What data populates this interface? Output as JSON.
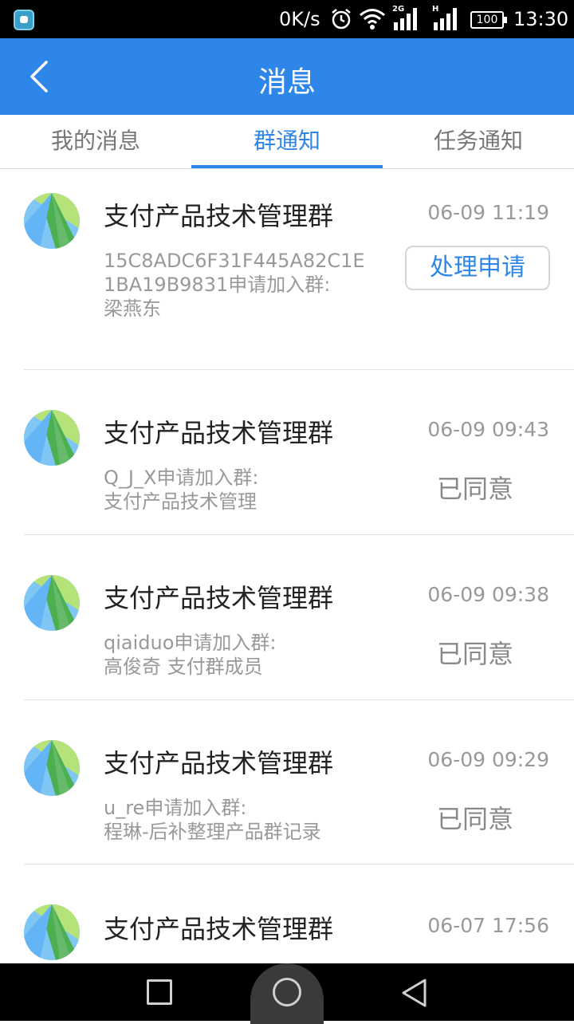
{
  "status_bar": {
    "net_speed": "0K/s",
    "network_2g": "2G",
    "network_h": "H",
    "battery": "100",
    "time": "13:30"
  },
  "header": {
    "title": "消息",
    "back_icon": "chevron-left-icon"
  },
  "tabs": [
    {
      "label": "我的消息",
      "active": false
    },
    {
      "label": "群通知",
      "active": true
    },
    {
      "label": "任务通知",
      "active": false
    }
  ],
  "notifications": [
    {
      "group": "支付产品技术管理群",
      "time": "06-09 11:19",
      "desc_line1": "15C8ADC6F31F445A82C1E1BA19B9831申请加入群:",
      "desc_line2": "梁燕东",
      "action_button": "处理申请"
    },
    {
      "group": "支付产品技术管理群",
      "time": "06-09 09:43",
      "desc_line1": "Q_J_X申请加入群:",
      "desc_line2": "支付产品技术管理",
      "status": "已同意"
    },
    {
      "group": "支付产品技术管理群",
      "time": "06-09 09:38",
      "desc_line1": "qiaiduo申请加入群:",
      "desc_line2": "高俊奇 支付群成员",
      "status": "已同意"
    },
    {
      "group": "支付产品技术管理群",
      "time": "06-09 09:29",
      "desc_line1": "u_re申请加入群:",
      "desc_line2": "程琳-后补整理产品群记录",
      "status": "已同意"
    },
    {
      "group": "支付产品技术管理群",
      "time": "06-07 17:56"
    }
  ],
  "nav_bar": {
    "recent_icon": "square-icon",
    "home_icon": "circle-icon",
    "back_icon": "triangle-back-icon"
  },
  "colors": {
    "primary": "#2f86e9",
    "muted_text": "#999999"
  }
}
